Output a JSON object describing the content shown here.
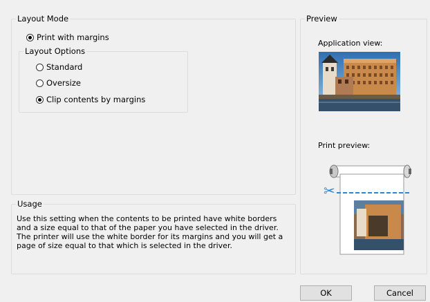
{
  "layout_mode": {
    "title": "Layout Mode",
    "print_with_margins": "Print with margins"
  },
  "layout_options": {
    "title": "Layout Options",
    "standard": "Standard",
    "oversize": "Oversize",
    "clip": "Clip contents by margins"
  },
  "usage": {
    "title": "Usage",
    "text": "Use this setting when the contents to be printed have white borders and a size equal to that of the paper you have selected in the driver. The printer will use the white border for its margins and you will get a page of size equal to that which is selected in the driver."
  },
  "preview": {
    "title": "Preview",
    "app_view_label": "Application view:",
    "print_preview_label": "Print preview:"
  },
  "buttons": {
    "ok": "OK",
    "cancel": "Cancel"
  },
  "colors": {
    "cut_line": "#2a86d4",
    "panel_bg": "#f0f0f0"
  },
  "icons": {
    "scissors": "scissors-icon"
  }
}
